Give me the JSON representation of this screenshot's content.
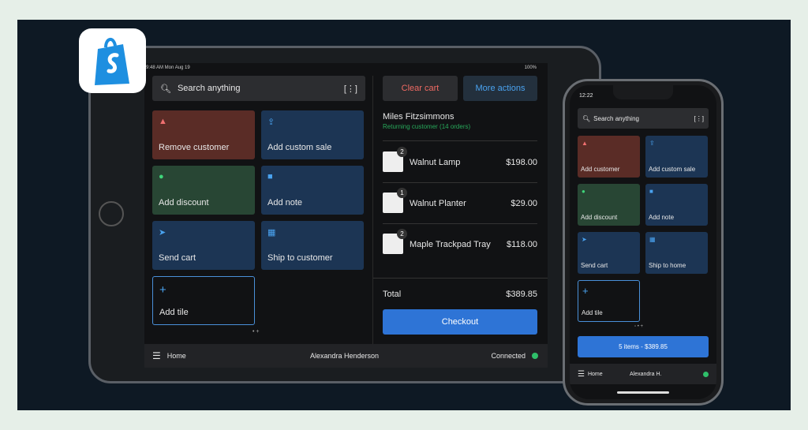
{
  "brand": {
    "logo": "Shopify bag logo",
    "color": "#5e8e3e"
  },
  "tablet": {
    "status": {
      "time": "9:48 AM  Mon Aug 19",
      "battery": "100%"
    },
    "search": {
      "placeholder": "Search anything",
      "icon": "search-icon",
      "scan_icon": "barcode-scan-icon"
    },
    "tiles": [
      {
        "label": "Remove customer",
        "icon": "person-icon",
        "color": "#5a2c26"
      },
      {
        "label": "Add custom sale",
        "icon": "upload-tray-icon",
        "color": "#1c3554"
      },
      {
        "label": "Add discount",
        "icon": "discount-icon",
        "color": "#284634"
      },
      {
        "label": "Add note",
        "icon": "note-icon",
        "color": "#1c3554"
      },
      {
        "label": "Send cart",
        "icon": "send-icon",
        "color": "#1c3554"
      },
      {
        "label": "Ship to customer",
        "icon": "shipping-icon",
        "color": "#1c3554"
      },
      {
        "label": "Add tile",
        "icon": "plus-icon"
      }
    ],
    "cart": {
      "clear_label": "Clear cart",
      "more_label": "More actions",
      "customer_name": "Miles Fitzsimmons",
      "customer_status": "Returning customer (14 orders)",
      "items": [
        {
          "qty": "2",
          "name": "Walnut Lamp",
          "price": "$198.00"
        },
        {
          "qty": "1",
          "name": "Walnut Planter",
          "price": "$29.00"
        },
        {
          "qty": "2",
          "name": "Maple Trackpad Tray",
          "price": "$118.00"
        }
      ],
      "total_label": "Total",
      "total": "$389.85",
      "checkout_label": "Checkout"
    },
    "bottom": {
      "home": "Home",
      "user": "Alexandra Henderson",
      "status": "Connected"
    }
  },
  "phone": {
    "status": {
      "time": "12:22"
    },
    "search": {
      "placeholder": "Search anything"
    },
    "tiles": [
      {
        "label": "Add customer"
      },
      {
        "label": "Add custom sale"
      },
      {
        "label": "Add discount"
      },
      {
        "label": "Add note"
      },
      {
        "label": "Send cart"
      },
      {
        "label": "Ship to home"
      },
      {
        "label": "Add tile"
      }
    ],
    "cart_button": "5 items - $389.85",
    "bottom": {
      "home": "Home",
      "user": "Alexandra H."
    }
  }
}
